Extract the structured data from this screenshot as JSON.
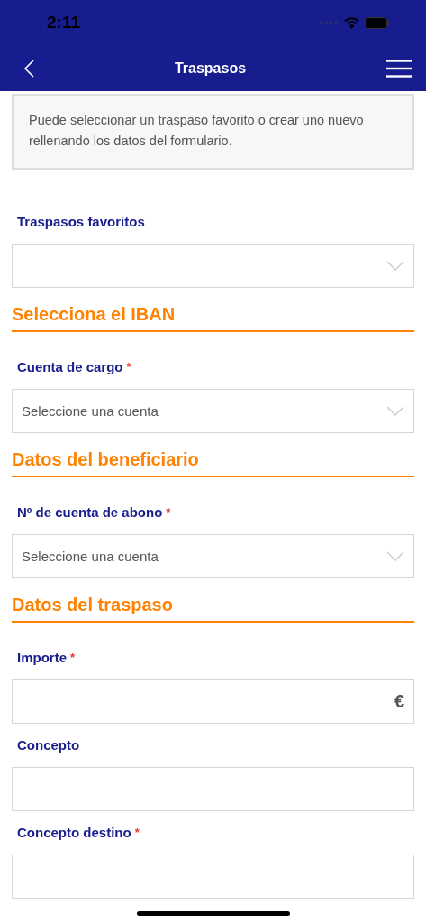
{
  "status_bar": {
    "time": "2:11"
  },
  "nav": {
    "title": "Traspasos"
  },
  "info": "Puede seleccionar un traspaso favorito o crear uno nuevo rellenando los datos del formulario.",
  "items": [
    {
      "kind": "select",
      "label": "Traspasos favoritos"
    },
    {
      "kind": "section",
      "title": "Selecciona el IBAN"
    },
    {
      "kind": "select",
      "label": "Cuenta de cargo",
      "required_mark": "*",
      "placeholder": "Seleccione una cuenta"
    },
    {
      "kind": "section",
      "title": "Datos del beneficiario"
    },
    {
      "kind": "select",
      "label": "Nº de cuenta de abono",
      "required_mark": "*",
      "placeholder": "Seleccione una cuenta"
    },
    {
      "kind": "section",
      "title": "Datos del traspaso"
    },
    {
      "kind": "input",
      "label": "Importe",
      "required_mark": "*",
      "suffix": "€"
    },
    {
      "kind": "input",
      "label": "Concepto"
    },
    {
      "kind": "input",
      "label": "Concepto destino",
      "required_mark": "*"
    }
  ]
}
